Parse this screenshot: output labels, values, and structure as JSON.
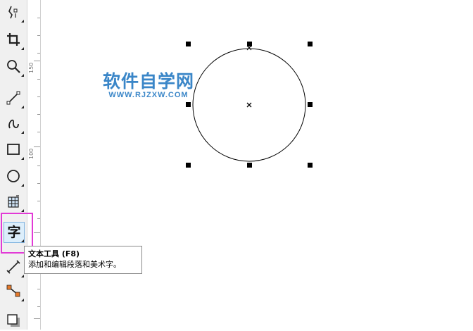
{
  "toolbox": {
    "tools": [
      {
        "name": "shape-tool",
        "icon": "shape-node-icon"
      },
      {
        "name": "crop-tool",
        "icon": "crop-icon"
      },
      {
        "name": "zoom-tool",
        "icon": "magnifier-icon"
      },
      {
        "name": "freehand-tool",
        "icon": "freehand-line-icon"
      },
      {
        "name": "smart-drawing-tool",
        "icon": "curve-icon"
      },
      {
        "name": "rectangle-tool",
        "icon": "rectangle-icon"
      },
      {
        "name": "ellipse-tool",
        "icon": "ellipse-icon"
      },
      {
        "name": "graph-paper-tool",
        "icon": "graph-paper-icon"
      },
      {
        "name": "text-tool",
        "icon": "text-tool-icon",
        "glyph": "字",
        "active": true
      },
      {
        "name": "dimension-tool",
        "icon": "dimension-icon"
      },
      {
        "name": "connector-tool",
        "icon": "connector-icon"
      },
      {
        "name": "drop-shadow-tool",
        "icon": "drop-shadow-icon"
      }
    ]
  },
  "ruler": {
    "labels": [
      "150",
      "100"
    ]
  },
  "watermark": {
    "title": "软件自学网",
    "url": "WWW.RJZXW.COM"
  },
  "tooltip": {
    "title": "文本工具 (F8)",
    "description": "添加和编辑段落和美术字。"
  },
  "colors": {
    "highlight": "#e23ad6",
    "watermark": "#3a86c8",
    "toolbox_bg": "#f0f0f0"
  }
}
